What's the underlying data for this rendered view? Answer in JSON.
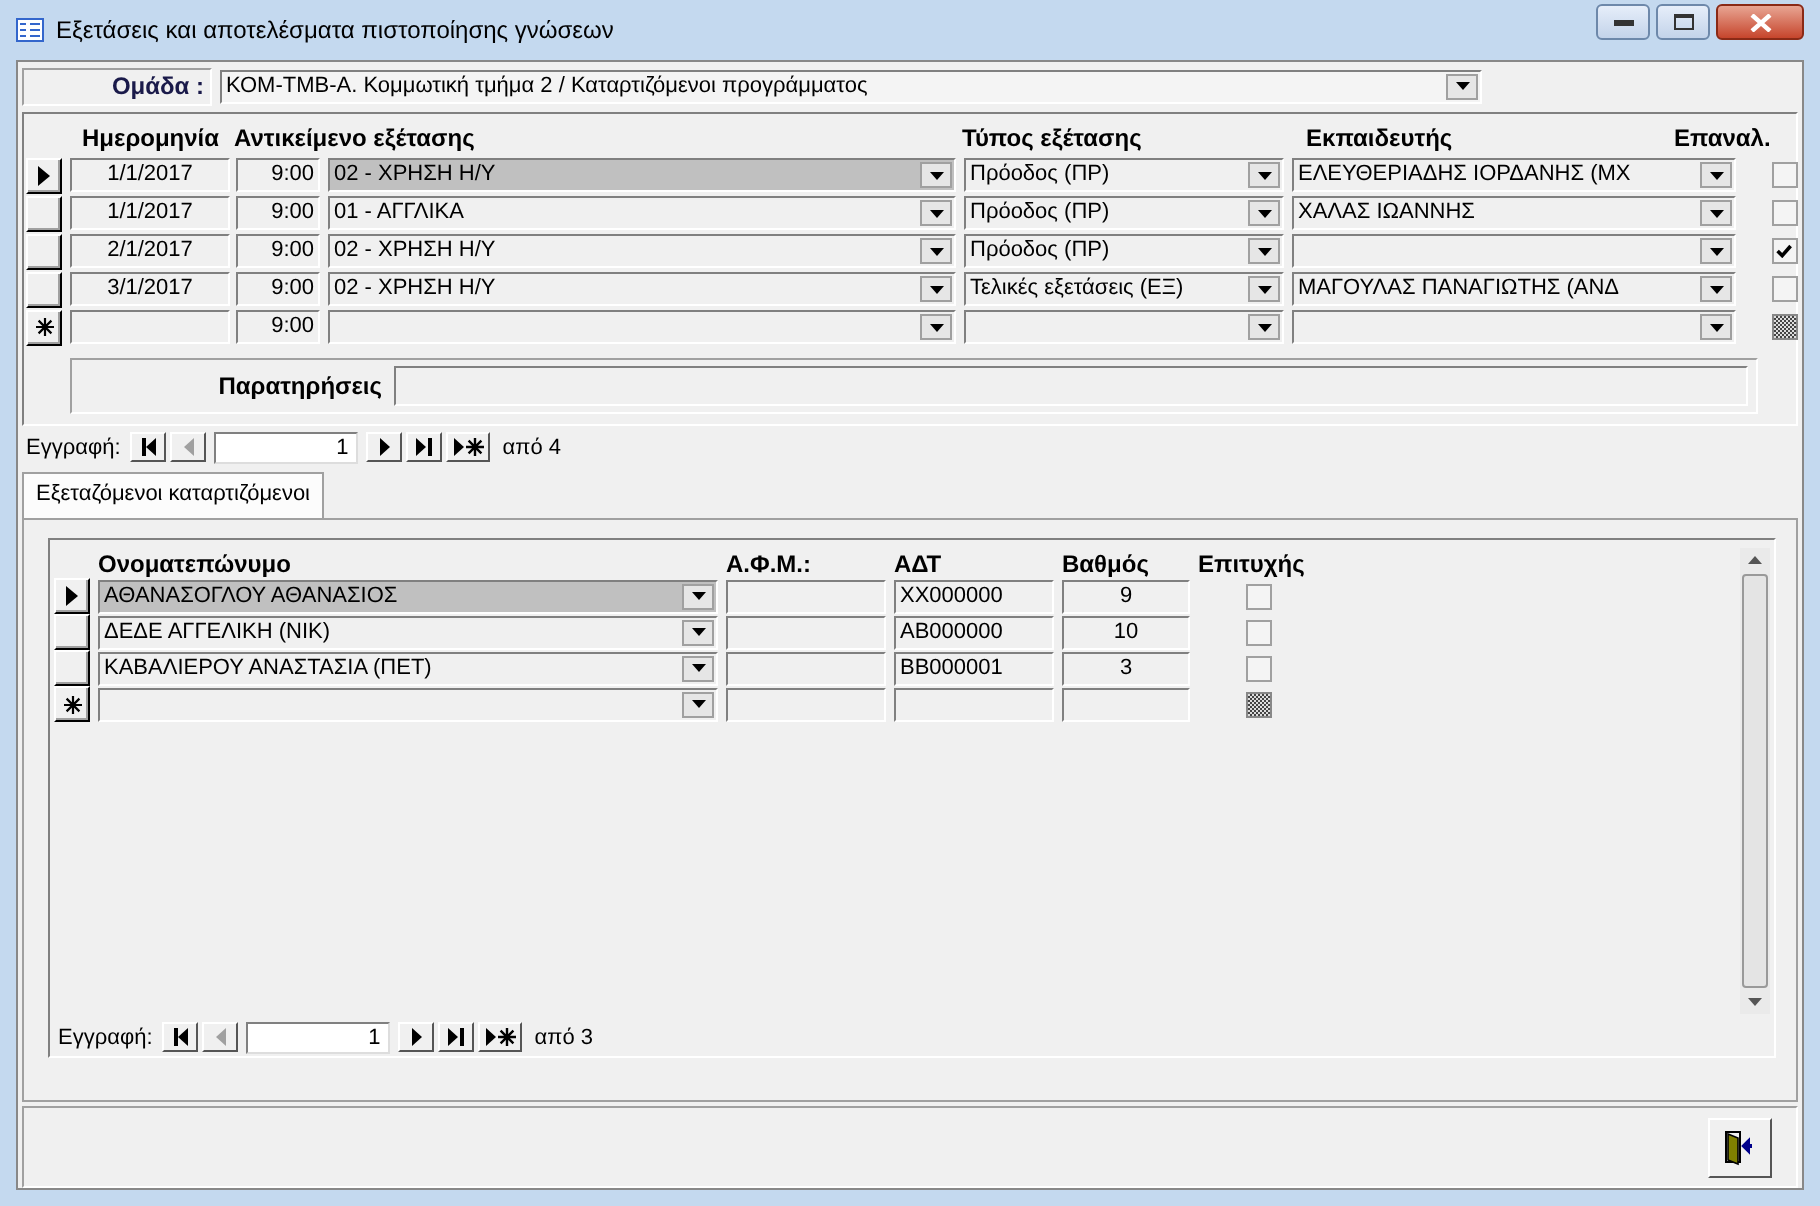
{
  "window": {
    "title": "Εξετάσεις και αποτελέσματα πιστοποίησης γνώσεων"
  },
  "group": {
    "label": "Ομάδα :",
    "value": "ΚΟΜ-ΤΜΒ-Α. Κομμωτική τμήμα 2 / Καταρτιζόμενοι προγράμματος"
  },
  "exams": {
    "columns": [
      "Ημερομηνία",
      "Αντικείμενο εξέτασης",
      "Τύπος εξέτασης",
      "Εκπαιδευτής",
      "Επαναλ."
    ],
    "rows": [
      {
        "kind": "record",
        "selected": true,
        "date": "1/1/2017",
        "time": "9:00",
        "subject": "02 - ΧΡΗΣΗ Η/Υ",
        "type": "Πρόοδος (ΠΡ)",
        "instructor": "ΕΛΕΥΘΕΡΙΑΔΗΣ ΙΟΡΔΑΝΗΣ (ΜΧ",
        "checked": false
      },
      {
        "kind": "record",
        "selected": false,
        "date": "1/1/2017",
        "time": "9:00",
        "subject": "01 - ΑΓΓΛΙΚΑ",
        "type": "Πρόοδος (ΠΡ)",
        "instructor": "ΧΑΛΑΣ ΙΩΑΝΝΗΣ",
        "checked": false
      },
      {
        "kind": "record",
        "selected": false,
        "date": "2/1/2017",
        "time": "9:00",
        "subject": "02 - ΧΡΗΣΗ Η/Υ",
        "type": "Πρόοδος (ΠΡ)",
        "checked": true
      },
      {
        "kind": "record",
        "selected": false,
        "date": "3/1/2017",
        "time": "9:00",
        "subject": "02 - ΧΡΗΣΗ Η/Υ",
        "type": "Τελικές εξετάσεις (ΕΞ)",
        "instructor": "ΜΑΓΟΥΛΑΣ ΠΑΝΑΓΙΩΤΗΣ (ΑΝΔ",
        "checked": false
      },
      {
        "kind": "new",
        "selected": false,
        "time": "9:00"
      }
    ],
    "remarks_label": "Παρατηρήσεις",
    "navigator": {
      "label": "Εγγραφή:",
      "current": "1",
      "total": "από 4"
    }
  },
  "tabs": [
    {
      "label": "Εξεταζόμενοι καταρτιζόμενοι",
      "selected": true
    }
  ],
  "trainees": {
    "columns": [
      "Ονοματεπώνυμο",
      "Α.Φ.Μ.:",
      "ΑΔΤ",
      "Βαθμός",
      "Επιτυχής"
    ],
    "rows": [
      {
        "kind": "record",
        "selected": true,
        "name": "ΑΘΑΝΑΣΟΓΛΟΥ ΑΘΑΝΑΣΙΟΣ",
        "id_card": "ΧΧ000000",
        "grade": "9",
        "passed": false
      },
      {
        "kind": "record",
        "selected": false,
        "name": "ΔΕΔΕ ΑΓΓΕΛΙΚΗ (ΝΙΚ)",
        "id_card": "ΑΒ000000",
        "grade": "10",
        "passed": false
      },
      {
        "kind": "record",
        "selected": false,
        "name": "ΚΑΒΑΛΙΕΡΟΥ ΑΝΑΣΤΑΣΙΑ (ΠΕΤ)",
        "id_card": "ΒΒ000001",
        "grade": "3",
        "passed": false
      },
      {
        "kind": "new",
        "selected": false
      }
    ],
    "navigator": {
      "label": "Εγγραφή:",
      "current": "1",
      "total": "από 3"
    }
  }
}
